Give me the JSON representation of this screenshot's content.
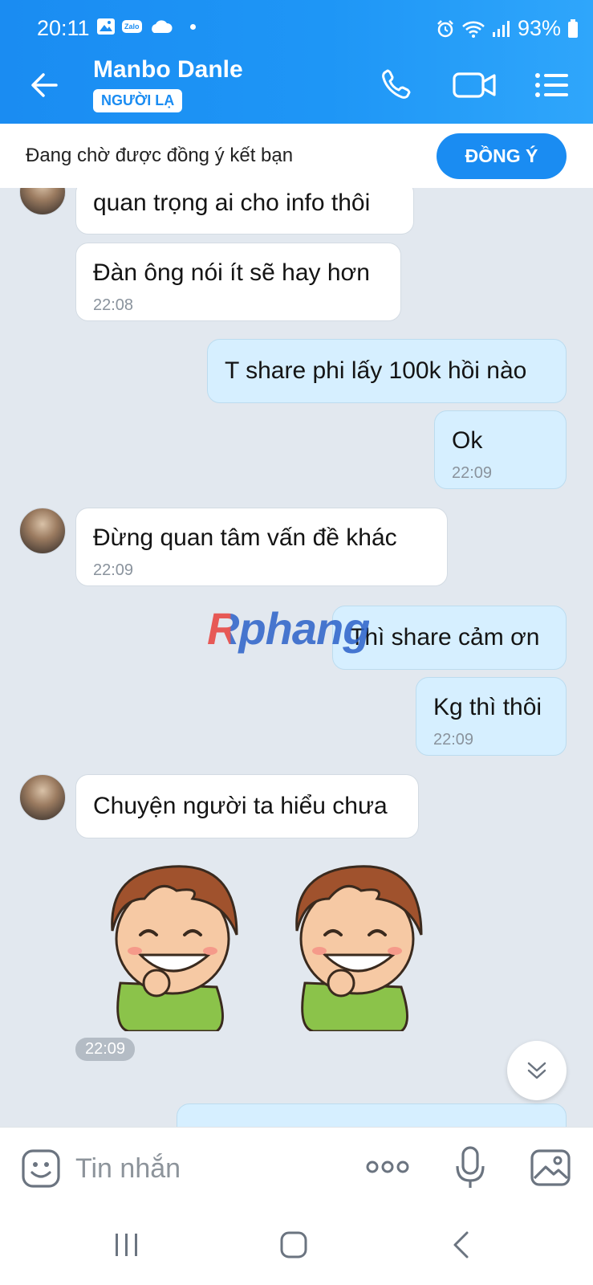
{
  "status_bar": {
    "time": "20:11",
    "battery": "93%",
    "icons_left": [
      "gallery-icon",
      "zalo-icon",
      "cloud-icon",
      "dot-icon"
    ],
    "zalo_text": "Zalo",
    "icons_right": [
      "alarm-icon",
      "wifi-icon",
      "signal-icon",
      "battery-icon"
    ]
  },
  "header": {
    "title": "Manbo Danle",
    "badge": "NGƯỜI LẠ",
    "actions": [
      "back-arrow-icon",
      "phone-icon",
      "video-call-icon",
      "menu-icon"
    ]
  },
  "friend_request": {
    "text": "Đang chờ được đồng ý kết bạn",
    "button": "ĐỒNG Ý",
    "accent": "#1a8cf2"
  },
  "messages": [
    {
      "side": "in",
      "text": "quan trọng ai cho info thôi",
      "time": ""
    },
    {
      "side": "in",
      "text": "Đàn ông nói ít sẽ hay hơn",
      "time": "22:08"
    },
    {
      "side": "out",
      "text": "T share phi lấy 100k hồi nào",
      "time": ""
    },
    {
      "side": "out",
      "text": "Ok",
      "time": "22:09"
    },
    {
      "side": "in",
      "text": "Đừng quan  tâm  vấn đề khác",
      "time": "22:09"
    },
    {
      "side": "out",
      "text": "Thì share cảm ơn",
      "time": ""
    },
    {
      "side": "out",
      "text": "Kg thì thôi",
      "time": "22:09"
    },
    {
      "side": "in",
      "text": "Chuyện người ta hiểu chưa",
      "time": ""
    }
  ],
  "sticker_time": "22:09",
  "watermark": "Rphang",
  "composer": {
    "placeholder": "Tin nhắn",
    "icons": [
      "emoji-icon",
      "more-icon",
      "microphone-icon",
      "image-icon"
    ]
  },
  "navbar": [
    "recent-apps-icon",
    "home-icon",
    "back-icon"
  ],
  "colors": {
    "header_gradient_start": "#1a8cf2",
    "header_gradient_end": "#2fa6fb",
    "outgoing_bubble": "#d6efff",
    "incoming_bubble": "#ffffff",
    "chat_background": "#e2e8ef"
  }
}
